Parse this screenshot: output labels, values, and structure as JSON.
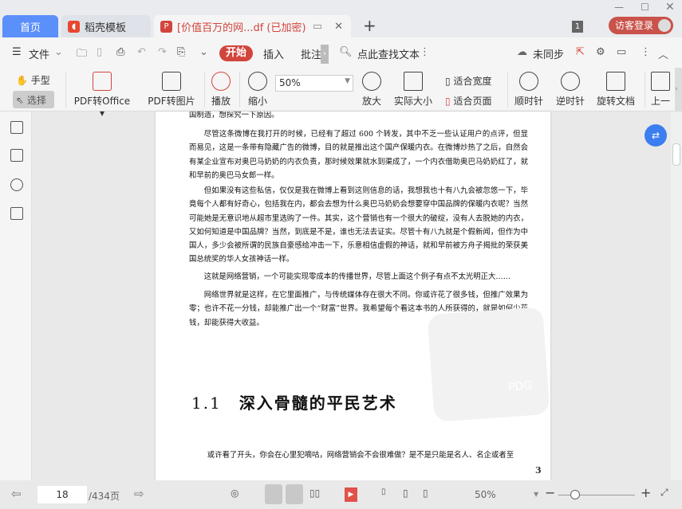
{
  "tabs": {
    "home": "首页",
    "template": "稻壳模板",
    "document": "[价值百万的网...df (已加密)",
    "new_tab": "+"
  },
  "window": {
    "badge": "1",
    "login": "访客登录"
  },
  "menu": {
    "file": "文件",
    "start": "开始",
    "insert": "插入",
    "annotate": "批注",
    "search": "点此查找文本",
    "sync": "未同步"
  },
  "tools": {
    "hand": "手型",
    "select": "选择",
    "pdf_office": "PDF转Office",
    "pdf_image": "PDF转图片",
    "play": "播放",
    "zoom_out": "缩小",
    "zoom_value": "50%",
    "zoom_in": "放大",
    "actual_size": "实际大小",
    "fit_width": "适合宽度",
    "fit_page": "适合页面",
    "clockwise": "顺时针",
    "counter": "逆时针",
    "rotate": "旋转文档",
    "prev": "上一"
  },
  "document": {
    "paragraphs": [
      "国制造，想探究一下原因。",
      "尽管这条微博在我打开的时候，已经有了超过 600 个转发，其中不乏一些认证用户的点评，但显而易见，这是一条带有隐藏广告的微博，目的就是推出这个国产保暖内衣。在微博炒热了之后，自然会有某企业宣布对奥巴马奶奶的内衣负责，那时候效果就水到渠成了，一个内衣借助奥巴马奶奶红了，就和早前的奥巴马女郎一样。",
      "但如果没有这些私信，仅仅是我在微博上看到这则信息的话，我想我也十有八九会被忽悠一下，毕竟每个人都有好奇心，包括我在内，都会去想为什么奥巴马奶奶会想要穿中国品牌的保暖内衣呢？当然可能她是无意识地从超市里选购了一件。其实，这个营销也有一个很大的破绽，没有人去脱她的内衣，又如何知道是中国品牌？当然，到底是不是，谁也无法去证实。尽管十有八九就是个假新闻，但作为中国人，多少会被所谓的民族自豪感给冲击一下，乐意相信虚假的神话，就和早前被方舟子揭批的荣获美国总统奖的华人女孩神话一样。",
      "这就是网络营销，一个可能实现零成本的传播世界，尽管上面这个例子有点不太光明正大……",
      "网络世界就是这样，在它里面推广，与传统媒体存在很大不同。你或许花了很多钱，但推广效果为零；也许不花一分钱，却能推广出一个“财富”世界。我希望每个看这本书的人所获得的，就是如何少花钱，却能获得大收益。",
      "或许看了开头，你会在心里犯嘀咕，网络营销会不会很难做？是不是只能是名人、名企或者至"
    ],
    "section_number": "1.1",
    "section_title": "深入骨髓的平民艺术",
    "page_number": "3",
    "watermark": "PDG"
  },
  "status": {
    "current_page": "18",
    "total": "/434页",
    "zoom": "50%"
  },
  "colors": {
    "accent": "#d2453d",
    "home_tab": "#5b8ff9",
    "float_btn": "#3b7ef0"
  }
}
